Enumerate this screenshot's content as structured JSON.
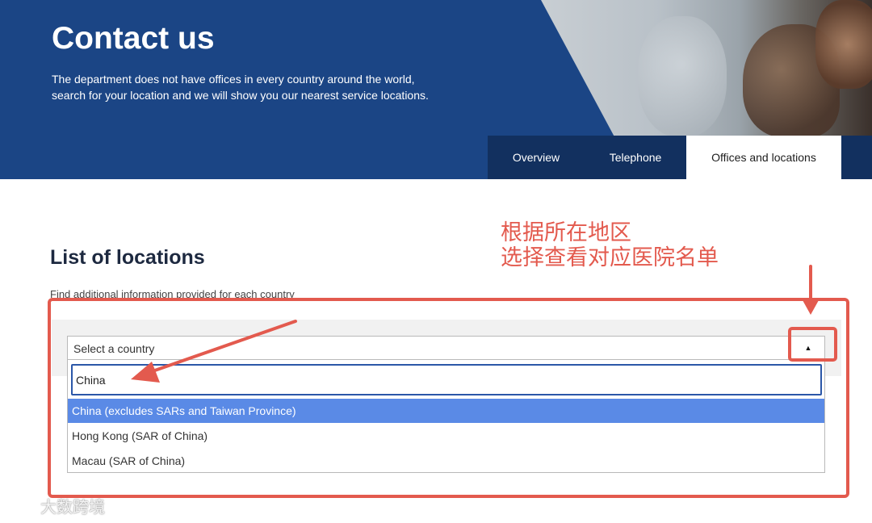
{
  "hero": {
    "title": "Contact us",
    "description": "The department does not have offices in every country around the world, search for your location and we will show you our nearest service locations."
  },
  "tabs": [
    {
      "label": "Overview"
    },
    {
      "label": "Telephone"
    },
    {
      "label": "Offices and locations",
      "active": true
    }
  ],
  "section": {
    "title": "List of locations",
    "subtitle": "Find additional information provided for each country"
  },
  "country_select": {
    "label": "Select a country",
    "arrow": "▲",
    "search_value": "China",
    "options": [
      {
        "label": "China (excludes SARs and Taiwan Province)",
        "highlighted": true
      },
      {
        "label": "Hong Kong (SAR of China)"
      },
      {
        "label": "Macau (SAR of China)"
      }
    ]
  },
  "annotation": {
    "text": "根据所在地区\n选择查看对应医院名单",
    "color": "#e35a4e"
  },
  "watermark": {
    "text": "大数跨境"
  },
  "colors": {
    "hero_bg": "#1b4585",
    "tab_bg": "#12305f",
    "highlight": "#5a8ae6",
    "focus_border": "#2b57a8"
  }
}
